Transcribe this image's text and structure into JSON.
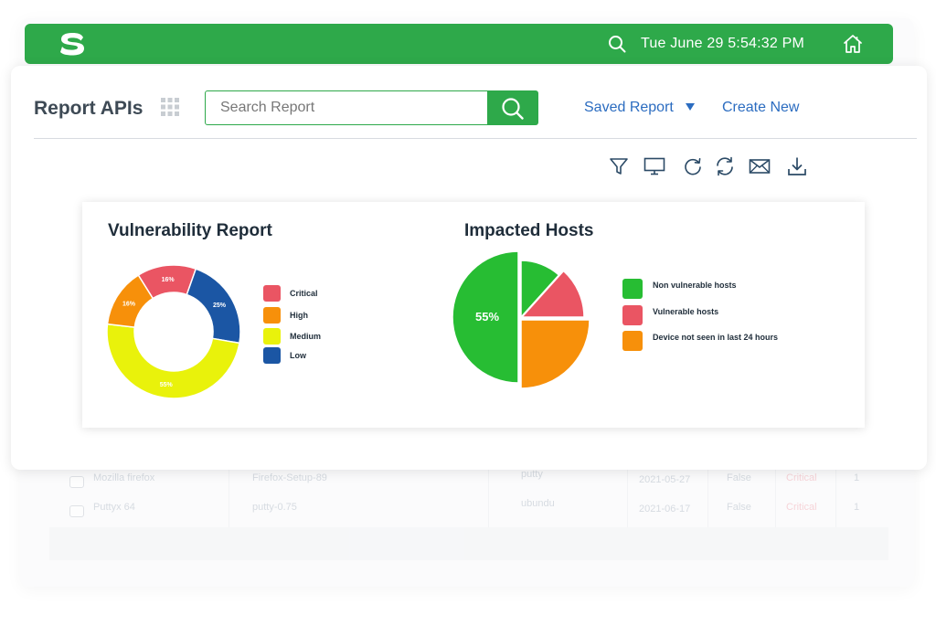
{
  "header": {
    "time_text": "Tue June 29 5:54:32 PM",
    "brand_color": "#2ea94a"
  },
  "page": {
    "title": "Report APIs",
    "search_placeholder": "Search Report",
    "saved_report_label": "Saved Report",
    "create_new_label": "Create New",
    "link_color": "#2b6cc0"
  },
  "toolbar": {
    "icons": [
      "filter-icon",
      "monitor-icon",
      "refresh-icon",
      "sync-icon",
      "mail-icon",
      "download-icon"
    ]
  },
  "vulnerability_chart": {
    "title": "Vulnerability Report",
    "legend": [
      "Critical",
      "High",
      "Medium",
      "Low"
    ],
    "slices": [
      {
        "name": "Critical",
        "value": 16,
        "label": "16%",
        "color": "#ea5563"
      },
      {
        "name": "Low",
        "value": 25,
        "label": "25%",
        "color": "#1b56a4"
      },
      {
        "name": "Medium",
        "value": 55,
        "label": "55%",
        "color": "#e9f20b"
      },
      {
        "name": "High",
        "value": 16,
        "label": "16%",
        "color": "#f7900a"
      }
    ]
  },
  "hosts_chart": {
    "title": "Impacted Hosts",
    "legend": [
      "Non vulnerable hosts",
      "Vulnerable hosts",
      "Device not seen in last 24 hours"
    ],
    "colors": [
      "#27bd33",
      "#ea5563",
      "#f7900a"
    ],
    "center_label": "55%"
  },
  "chart_data": [
    {
      "type": "pie",
      "title": "Vulnerability Report",
      "categories": [
        "Critical",
        "Low",
        "Medium",
        "High"
      ],
      "values": [
        16,
        25,
        55,
        16
      ],
      "labels": [
        "16%",
        "25%",
        "55%",
        "16%"
      ],
      "legend": "right"
    },
    {
      "type": "pie",
      "title": "Impacted Hosts",
      "categories": [
        "Non vulnerable hosts",
        "Vulnerable hosts",
        "Device not seen in last 24 hours"
      ],
      "values": [
        55,
        12,
        23
      ],
      "labels": [
        "55%",
        "",
        ""
      ],
      "legend": "right"
    }
  ],
  "background_table": {
    "rows": [
      {
        "name": "Mozilla firefox",
        "file": "Firefox-Setup-89",
        "owner": "putty",
        "date": "2021-05-27",
        "flag": "False",
        "severity": "Critical",
        "count": "1"
      },
      {
        "name": "Puttyx 64",
        "file": "putty-0.75",
        "owner": "ubundu",
        "date": "2021-06-17",
        "flag": "False",
        "severity": "Critical",
        "count": "1"
      }
    ]
  }
}
